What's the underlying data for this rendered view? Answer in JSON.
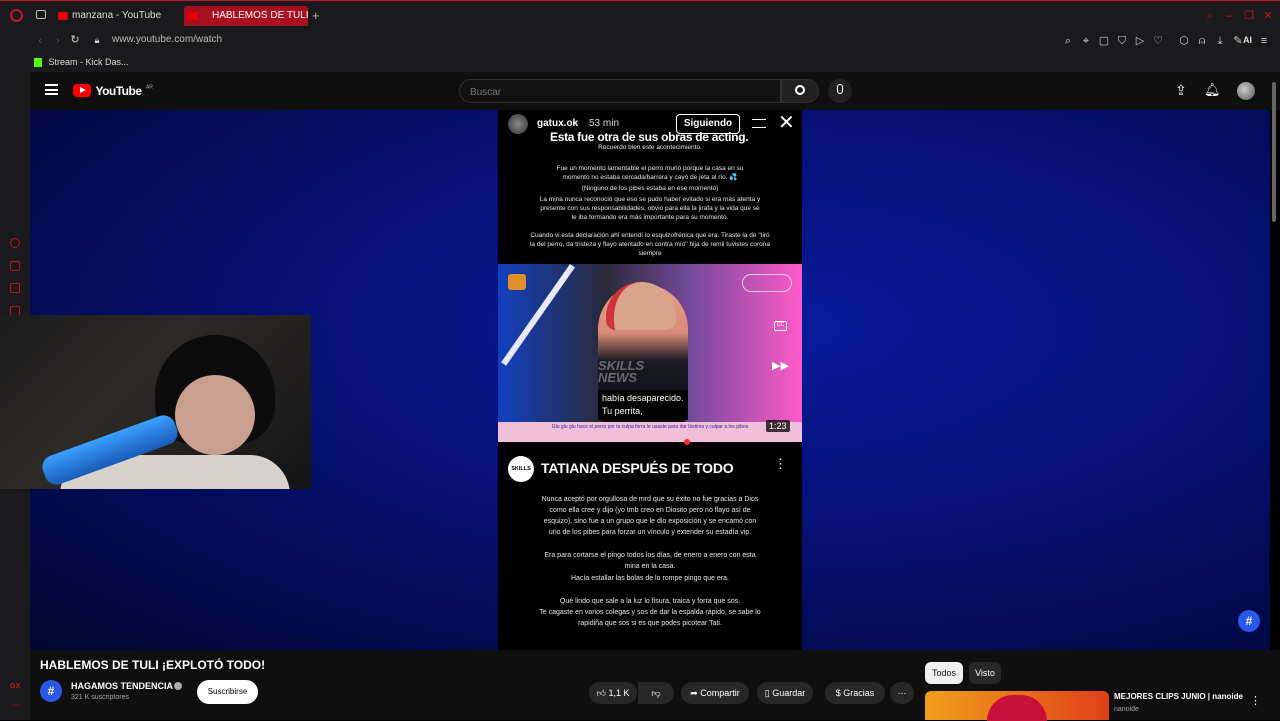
{
  "browser": {
    "tabs": [
      {
        "label": "manzana - YouTube",
        "active": false
      },
      {
        "label": "HABLEMOS DE TULI ¡E",
        "active": true
      }
    ],
    "new_tab_label": "+",
    "url": "www.youtube.com/watch",
    "bookmarks": [
      {
        "label": "Stream - Kick Das..."
      }
    ],
    "ai_label": "AI"
  },
  "youtube": {
    "logo_text": "YouTube",
    "region": "AR",
    "search_placeholder": "Buscar"
  },
  "story": {
    "username": "gatux.ok",
    "time": "53 min",
    "follow_label": "Siguiendo",
    "headline": "Esta fue otra de sus obras de acting.",
    "paragraphs": [
      "Recuerdo bien este acontecimiento.",
      "Fue un momento lamentable el perro murió porque la casa en su momento no estaba cercada/barrera y cayó de jeta al río. 💦",
      "(Ninguno de los pibes estaba en ese momento)",
      "La mina nunca reconoció que eso se pudo haber evitado si era más atenta y presente con sus responsabilidades, obvio para ella la jirafa y la vida que se le iba formando era más importante para su momento.",
      "Cuando vi esta declaración ahí entendí lo esquizofrénica que era. Tiraste la de \"tiró la del perro, da tristeza y flayo atentado en contra mío\" hija de remil tuvistes corona siempre"
    ],
    "clip_caption_1": "había desaparecido.",
    "clip_caption_2": "Tu perrita,",
    "clip_watermark": "SKILLS NEWS",
    "clip_subtitle": "Glu glu glu hace el perro por tu culpa forra le usaste para dar lástima y culpar a los pibes",
    "clip_duration": "1:23",
    "post_brand": "SKILLS",
    "post_title": "TATIANA DESPUÉS DE TODO",
    "post_paragraphs": [
      "Nunca aceptó por orgullosa de mrd que su éxito no fue gracias a Dios como ella cree y dijo (yo tmb creo en Diosito pero no flayo así de esquizo), sino fue a un grupo que le dio exposición y se encamó con uno de los pibes para forzar un vínculo y extender su estadía vip.",
      "Era para cortarse el pingo todos los días, de enero a enero con esta mina en la casa.",
      "Hacía estallar las bolas de lo rompe pingo que era.",
      "Qué lindo que sale a la luz lo fisura, traica y forra que sos.",
      "Te cagaste en varios colegas y sos de dar la espalda rápido, se sabe lo rapidiña que sos si es que podes picotear Tati."
    ]
  },
  "video": {
    "title": "HABLEMOS DE TULI ¡EXPLOTÓ TODO!",
    "channel": "HAGAMOS TENDENCIA",
    "subscribers": "321 K suscriptores",
    "subscribe_label": "Suscribirse",
    "likes": "1,1 K",
    "share_label": "Compartir",
    "save_label": "Guardar",
    "thanks_label": "Gracias",
    "channel_logo_text": "#"
  },
  "sidebar_filters": [
    {
      "label": "Todos",
      "active": true
    },
    {
      "label": "Visto",
      "active": false
    }
  ],
  "recommended": [
    {
      "title": "MEJORES CLIPS JUNIO | nanoide",
      "channel": "nanoide"
    }
  ],
  "opera_side_label": "GX",
  "colors": {
    "accent": "#c4162a",
    "youtube_red": "#ff0000",
    "background": "#0f0f0f",
    "player_blue": "#06127a"
  }
}
